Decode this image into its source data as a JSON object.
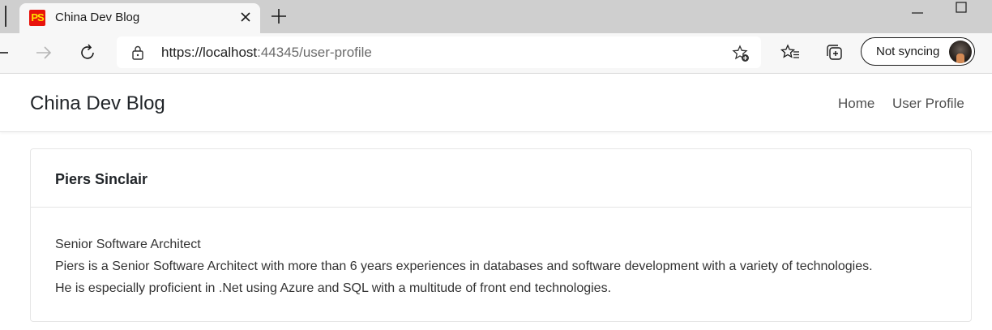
{
  "browser": {
    "tab": {
      "favicon_text": "PS",
      "title": "China Dev Blog"
    },
    "address": {
      "url_host": "https://localhost",
      "url_rest": ":44345/user-profile"
    },
    "sync_label": "Not syncing",
    "icons": [
      "back-arrow-icon",
      "forward-arrow-icon",
      "refresh-icon",
      "lock-icon",
      "add-favorite-icon",
      "favorites-icon",
      "collections-icon",
      "close-icon",
      "plus-icon",
      "minimize-icon",
      "maximize-icon"
    ]
  },
  "site": {
    "brand": "China Dev Blog",
    "nav": {
      "home": "Home",
      "profile": "User Profile"
    }
  },
  "profile": {
    "name": "Piers Sinclair",
    "title": "Senior Software Architect",
    "bio_line1": "Piers is a Senior Software Architect with more than 6 years experiences in databases and software development with a variety of technologies.",
    "bio_line2": "He is especially proficient in .Net using Azure and SQL with a multitude of front end technologies."
  },
  "colors": {
    "favicon_bg": "#e8130b",
    "favicon_text": "#ffe000",
    "tabstrip_bg": "#cfcfcf",
    "toolbar_bg": "#f7f7f7"
  }
}
